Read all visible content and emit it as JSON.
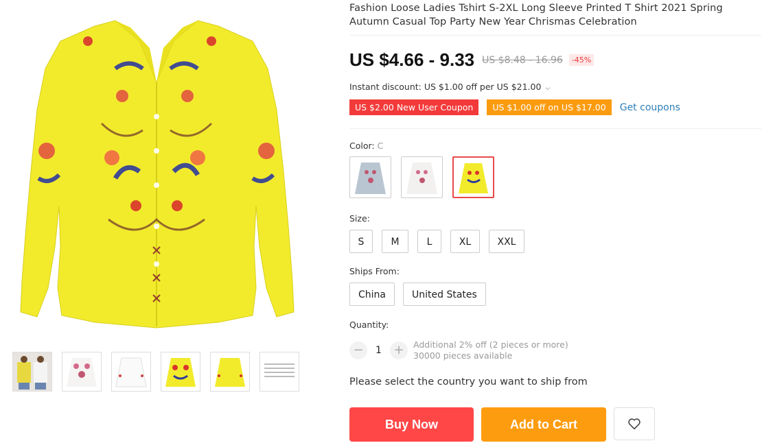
{
  "product": {
    "title": "Fashion Loose Ladies Tshirt S-2XL Long Sleeve Printed T Shirt 2021 Spring Autumn Casual Top Party New Year Chrismas Celebration",
    "price": "US $4.66 - 9.33",
    "old_price": "US $8.48 - 16.96",
    "discount": "-45%",
    "instant_discount": "Instant discount: US $1.00 off per US $21.00",
    "dropdown_icon": "chevron-down-icon"
  },
  "coupons": {
    "items": [
      {
        "label": "US $2.00 New User Coupon",
        "color": "#f33a3a"
      },
      {
        "label": "US $1.00 off on US $17.00",
        "color": "#fb9b0f"
      }
    ],
    "get_label": "Get coupons"
  },
  "color": {
    "label": "Color:",
    "selected": "C",
    "options": [
      "light-blue-floral",
      "white-floral",
      "yellow-floral"
    ]
  },
  "size": {
    "label": "Size:",
    "options": [
      "S",
      "M",
      "L",
      "XL",
      "XXL"
    ]
  },
  "ships_from": {
    "label": "Ships From:",
    "options": [
      "China",
      "United States"
    ]
  },
  "quantity": {
    "label": "Quantity:",
    "minus": "−",
    "plus": "+",
    "value": "1",
    "additional": "Additional 2% off (2 pieces or more)",
    "available": "30000 pieces available"
  },
  "notice": "Please select the country you want to ship from",
  "actions": {
    "buy_now": "Buy Now",
    "add_to_cart": "Add to Cart",
    "wishlist_icon": "heart-icon"
  },
  "gallery": {
    "thumbnails": [
      "two-models",
      "white-pink-print",
      "white-plain",
      "yellow-print",
      "yellow-plain",
      "size-chart"
    ]
  },
  "colors": {
    "accent_red": "#ff4747",
    "accent_orange": "#fe9c0f",
    "link_blue": "#2d7fb9",
    "shirt_yellow": "#f2eb2c"
  }
}
